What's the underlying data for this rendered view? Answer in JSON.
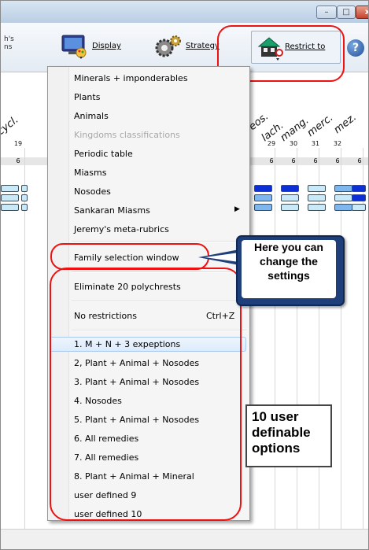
{
  "window": {
    "buttons": {
      "minimize": "–",
      "maximize": "□",
      "close": "x"
    }
  },
  "toolbar": {
    "cut_label": "h's\nns",
    "display": {
      "label": "Display",
      "icon": "monitor-palette-icon"
    },
    "strategy": {
      "label": "Strategy",
      "icon": "gears-icon"
    },
    "restrict": {
      "label": "Restrict to",
      "icon": "house-filter-icon"
    },
    "help": {
      "label": "?"
    }
  },
  "remedies": [
    {
      "name": "cycl.",
      "num": "19",
      "six": "6"
    },
    {
      "name": "eos.",
      "num": "29",
      "six": "6"
    },
    {
      "name": "lach.",
      "num": "30",
      "six": "6"
    },
    {
      "name": "mang.",
      "num": "31",
      "six": "6"
    },
    {
      "name": "merc.",
      "num": "32",
      "six": "6"
    },
    {
      "name": "mez.",
      "num": "",
      "six": "6"
    }
  ],
  "menu": {
    "items": [
      {
        "label": "Minerals + imponderables",
        "disabled": false
      },
      {
        "label": "Plants",
        "disabled": false
      },
      {
        "label": "Animals",
        "disabled": false
      },
      {
        "label": "Kingdoms classifications",
        "disabled": true
      },
      {
        "label": "Periodic table",
        "disabled": false
      },
      {
        "label": "Miasms",
        "disabled": false
      },
      {
        "label": "Nosodes",
        "disabled": false
      },
      {
        "label": "Sankaran Miasms",
        "disabled": false,
        "submenu": "▶"
      },
      {
        "label": "Jeremy's meta-rubrics",
        "disabled": false
      },
      {
        "label": "Family selection window",
        "disabled": false
      },
      {
        "label": "Eliminate 20 polychrests",
        "disabled": false
      },
      {
        "label": "No restrictions",
        "disabled": false,
        "shortcut": "Ctrl+Z"
      }
    ],
    "user_options": [
      "1. M + N + 3 expeptions",
      "2, Plant + Animal + Nosodes",
      "3. Plant + Animal + Nosodes",
      "4. Nosodes",
      "5. Plant + Animal + Nosodes",
      "6. All remedies",
      "7. All remedies",
      "8. Plant + Animal + Mineral",
      "user defined 9",
      "user defined 10"
    ]
  },
  "annotations": {
    "bubble": "Here you can change the settings",
    "note": "10 user definable options"
  },
  "colors": {
    "highlight": "#e11111",
    "bubble": "#1f3f7a",
    "cell_light": "#c9e9f8",
    "cell_mid": "#7fb6ee",
    "cell_dark": "#0d2fd6"
  }
}
